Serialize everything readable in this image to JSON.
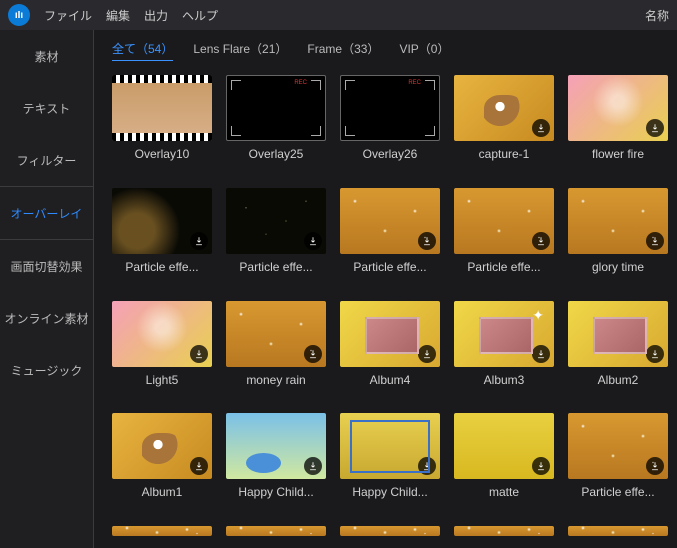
{
  "menubar": {
    "items": [
      "ファイル",
      "編集",
      "出力",
      "ヘルプ"
    ],
    "title": "名称"
  },
  "sidebar": {
    "items": [
      {
        "label": "素材"
      },
      {
        "label": "テキスト"
      },
      {
        "label": "フィルター"
      },
      {
        "label": "オーバーレイ",
        "active": true
      },
      {
        "label": "画面切替効果"
      },
      {
        "label": "オンライン素材"
      },
      {
        "label": "ミュージック"
      }
    ]
  },
  "tabs": [
    {
      "label": "全て（54）",
      "active": true
    },
    {
      "label": "Lens Flare（21）"
    },
    {
      "label": "Frame（33）"
    },
    {
      "label": "VIP（0）"
    }
  ],
  "items": [
    {
      "label": "Overlay10",
      "thumb": "film",
      "dl": false
    },
    {
      "label": "Overlay25",
      "thumb": "blackrec",
      "dl": false
    },
    {
      "label": "Overlay26",
      "thumb": "blackrec",
      "dl": false
    },
    {
      "label": "capture-1",
      "thumb": "cat",
      "dl": true
    },
    {
      "label": "flower fire",
      "thumb": "pink",
      "dl": true
    },
    {
      "label": "Particle effe...",
      "thumb": "darkglow",
      "dl": true
    },
    {
      "label": "Particle effe...",
      "thumb": "darkstars",
      "dl": true
    },
    {
      "label": "Particle effe...",
      "thumb": "spark",
      "dl": true
    },
    {
      "label": "Particle effe...",
      "thumb": "spark",
      "dl": true
    },
    {
      "label": "glory time",
      "thumb": "spark",
      "dl": true
    },
    {
      "label": "Light5",
      "thumb": "pink",
      "dl": true
    },
    {
      "label": "money rain",
      "thumb": "spark",
      "dl": true
    },
    {
      "label": "Album4",
      "thumb": "album",
      "dl": true
    },
    {
      "label": "Album3",
      "thumb": "album3",
      "dl": true
    },
    {
      "label": "Album2",
      "thumb": "album",
      "dl": true
    },
    {
      "label": "Album1",
      "thumb": "cat",
      "dl": true
    },
    {
      "label": "Happy Child...",
      "thumb": "blue",
      "dl": true
    },
    {
      "label": "Happy Child...",
      "thumb": "frame",
      "dl": true
    },
    {
      "label": "matte",
      "thumb": "yellow",
      "dl": true
    },
    {
      "label": "Particle effe...",
      "thumb": "spark",
      "dl": true
    }
  ]
}
